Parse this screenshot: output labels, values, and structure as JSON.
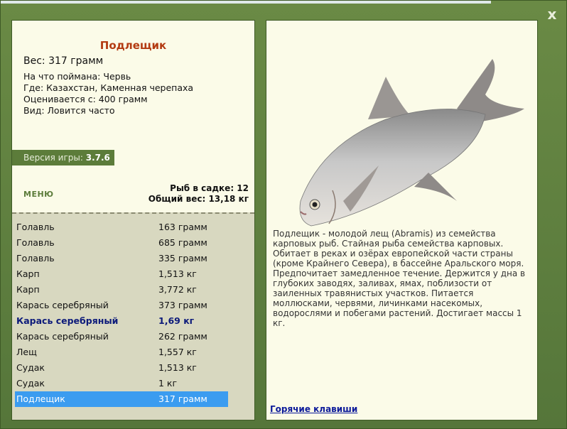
{
  "close_label": "x",
  "fish": {
    "title": "Подлещик",
    "weight_line": "Вес: 317 грамм",
    "info": [
      "На что поймана: Червь",
      "Где: Казахстан, Каменная черепаха",
      "Оценивается с: 400 грамм",
      "Вид: Ловится часто"
    ],
    "description": "Подлещик - молодой лещ (Abramis) из семейства карповых рыб. Стайная рыба семейства карповых. Обитает в реках и озёрах европейской части страны (кроме Крайнего Севера), в бассейне Аральского моря. Предпочитает замедленное течение. Держится у дна в глубоких заводях, заливах, ямах, поблизости от заиленных травянистых участков. Питается моллюсками, червями, личинками насекомых, водорослями и побегами растений. Достигает массы 1 кг."
  },
  "version": {
    "label": "Версия игры:",
    "value": "3.7.6"
  },
  "menu_label": "МЕНЮ",
  "cage": {
    "count_line": "Рыб в садке: 12",
    "total_line": "Общий вес: 13,18 кг"
  },
  "catch_list": [
    {
      "name": "Голавль",
      "weight": "163 грамм"
    },
    {
      "name": "Голавль",
      "weight": "685 грамм"
    },
    {
      "name": "Голавль",
      "weight": "335 грамм"
    },
    {
      "name": "Карп",
      "weight": "1,513 кг"
    },
    {
      "name": "Карп",
      "weight": "3,772 кг"
    },
    {
      "name": "Карась серебряный",
      "weight": "373 грамм"
    },
    {
      "name": "Карась серебряный",
      "weight": "1,69 кг"
    },
    {
      "name": "Карась серебряный",
      "weight": "262 грамм"
    },
    {
      "name": "Лещ",
      "weight": "1,557 кг"
    },
    {
      "name": "Судак",
      "weight": "1,513 кг"
    },
    {
      "name": "Судак",
      "weight": "1 кг"
    },
    {
      "name": "Подлещик",
      "weight": "317 грамм"
    }
  ],
  "hotkeys_label": "Горячие клавиши",
  "colors": {
    "title": "#b33b12",
    "accent_green": "#5c7c3a",
    "selection": "#3b9cf0",
    "bold_row": "#0c1a7a"
  }
}
